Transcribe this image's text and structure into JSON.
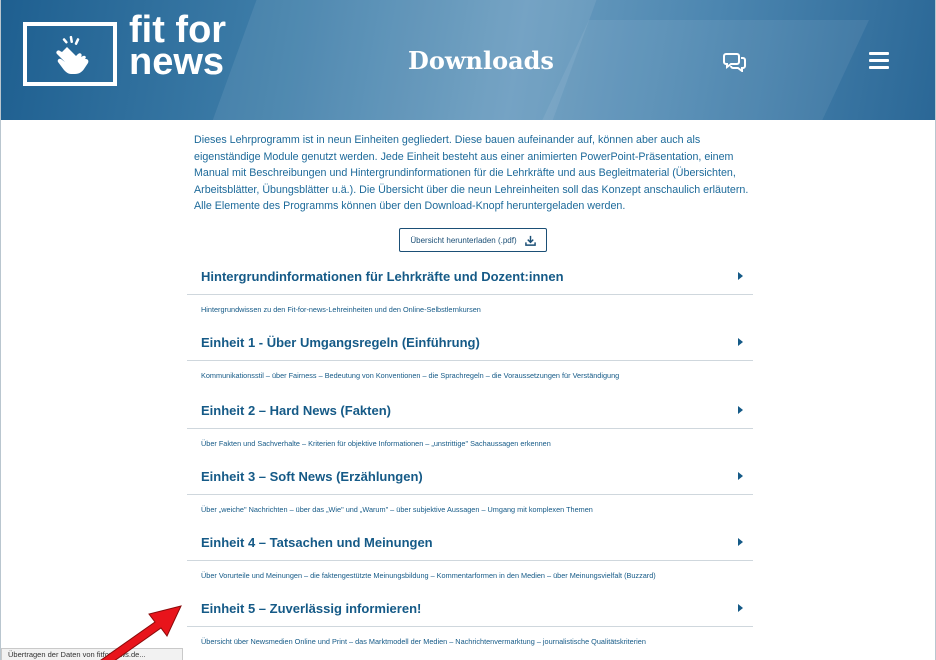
{
  "header": {
    "logo_line1": "fit for",
    "logo_line2": "news",
    "title": "Downloads",
    "icons": [
      "hand-tap-icon",
      "chat-icon",
      "menu-icon"
    ]
  },
  "intro": {
    "text": "Dieses Lehrprogramm ist in neun Einheiten gegliedert. Diese bauen aufeinander auf, können aber auch als eigenständige Module genutzt werden. Jede Einheit besteht aus einer animierten PowerPoint-Präsentation, einem Manual mit Beschreibungen und Hintergrundinformationen für die Lehrkräfte und aus Begleitmaterial (Übersichten, Arbeitsblätter, Übungsblätter u.ä.). Die Übersicht über die neun Lehreinheiten soll das Konzept anschaulich erläutern. Alle Elemente des Programms können über den Download-Knopf heruntergeladen werden."
  },
  "download_button": {
    "label": "Übersicht herunterladen (.pdf)"
  },
  "sections": [
    {
      "title": "Hintergrundinformationen für Lehrkräfte und Dozent:innen",
      "desc": "Hintergrundwissen zu den Fit-for-news-Lehreinheiten und den Online-Selbstlernkursen"
    },
    {
      "title": "Einheit 1 - Über Umgangsregeln (Einführung)",
      "desc": "Kommunikationsstil – über Fairness – Bedeutung von Konventionen – die Sprachregeln – die Voraussetzungen für Verständigung"
    },
    {
      "title": "Einheit 2 – Hard News (Fakten)",
      "desc": "Über Fakten und Sachverhalte – Kriterien für objektive Informationen – „unstrittige\" Sachaussagen erkennen"
    },
    {
      "title": "Einheit 3 – Soft News (Erzählungen)",
      "desc": "Über „weiche\" Nachrichten – über das „Wie\" und „Warum\" – über subjektive Aussagen – Umgang mit komplexen Themen"
    },
    {
      "title": "Einheit 4 – Tatsachen und Meinungen",
      "desc": "Über Vorurteile und Meinungen – die faktengestützte Meinungsbildung – Kommentarformen in den Medien – über Meinungsvielfalt (Buzzard)"
    },
    {
      "title": "Einheit 5 – Zuverlässig informieren!",
      "desc": "Übersicht über Newsmedien Online und Print – das Marktmodell der Medien – Nachrichtenvermarktung – journalistische Qualitätskriterien"
    }
  ],
  "statusbar": {
    "text": "Übertragen der Daten von fitfornews.de..."
  },
  "colors": {
    "header": "#2a6796",
    "text": "#155a87",
    "arrow": "#e8141b"
  }
}
